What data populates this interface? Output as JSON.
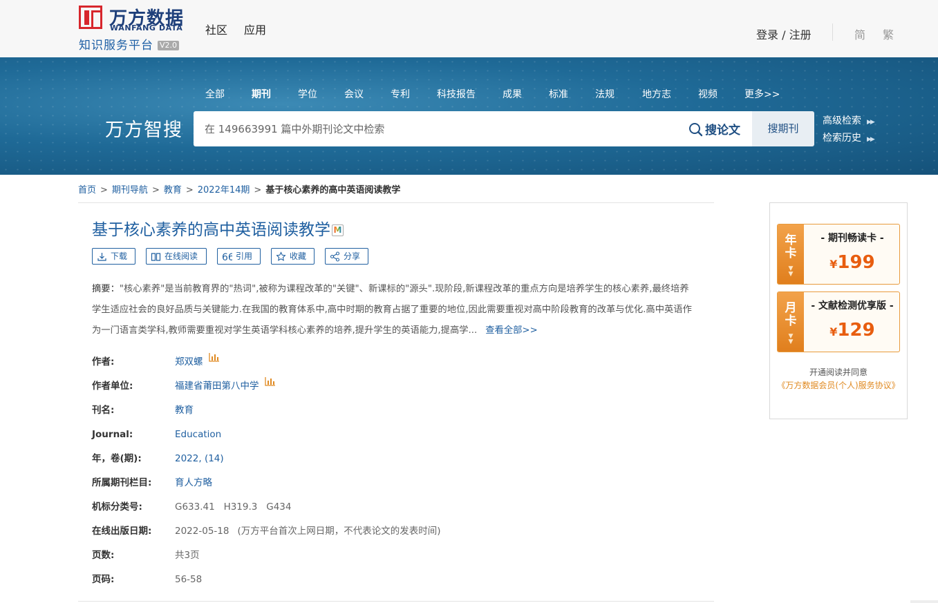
{
  "header": {
    "logo_cn": "万方数据",
    "logo_en": "WANFANG DATA",
    "logo_sub": "知识服务平台",
    "version": "V2.0",
    "nav": [
      "社区",
      "应用"
    ],
    "login": "登录 / 注册",
    "lang_simplified": "简",
    "lang_traditional": "繁"
  },
  "banner": {
    "categories": [
      "全部",
      "期刊",
      "学位",
      "会议",
      "专利",
      "科技报告",
      "成果",
      "标准",
      "法规",
      "地方志",
      "视频",
      "更多>>"
    ],
    "active_category": "期刊",
    "brand": "万方智搜",
    "search_placeholder": "在 149663991 篇中外期刊论文中检索",
    "search_button": "搜论文",
    "search_journal_button": "搜期刊",
    "advanced_search": "高级检索",
    "search_history": "检索历史"
  },
  "breadcrumb": {
    "items": [
      "首页",
      "期刊导航",
      "教育",
      "2022年14期"
    ],
    "current": "基于核心素养的高中英语阅读教学"
  },
  "article": {
    "title": "基于核心素养的高中英语阅读教学",
    "title_badge": "M",
    "actions": {
      "download": "下载",
      "read_online": "在线阅读",
      "cite": "引用",
      "favorite": "收藏",
      "share": "分享"
    },
    "abstract_label": "摘要：",
    "abstract_text": "\"核心素养\"是当前教育界的\"热词\",被称为课程改革的\"关键\"、新课标的\"源头\".现阶段,新课程改革的重点方向是培养学生的核心素养,最终培养学生适应社会的良好品质与关键能力.在我国的教育体系中,高中时期的教育占据了重要的地位,因此需要重视对高中阶段教育的改革与优化.高中英语作为一门语言类学科,教师需要重视对学生英语学科核心素养的培养,提升学生的英语能力,提高学...",
    "view_all": "查看全部>>",
    "meta": {
      "author_label": "作者:",
      "author": "郑双螺",
      "affiliation_label": "作者单位:",
      "affiliation": "福建省莆田第八中学",
      "journal_cn_label": "刊名:",
      "journal_cn": "教育",
      "journal_en_label": "Journal:",
      "journal_en": "Education",
      "year_issue_label": "年，卷(期):",
      "year_issue": "2022, (14)",
      "column_label": "所属期刊栏目:",
      "column": "育人方略",
      "classification_label": "机标分类号:",
      "classification": "G633.41   H319.3   G434",
      "online_date_label": "在线出版日期:",
      "online_date": "2022-05-18",
      "online_date_note": "(万方平台首次上网日期，不代表论文的发表时间)",
      "pages_count_label": "页数:",
      "pages_count": "共3页",
      "page_range_label": "页码:",
      "page_range": "56-58"
    }
  },
  "sidebar": {
    "year_card": {
      "tab": "年卡",
      "name": "- 期刊畅读卡 -",
      "currency": "¥",
      "price": "199"
    },
    "month_card": {
      "tab": "月卡",
      "name": "- 文献检测优享版 -",
      "currency": "¥",
      "price": "129"
    },
    "agree_text": "开通阅读并同意",
    "agree_link": "《万方数据会员(个人)服务协议》"
  },
  "colors": {
    "link_blue": "#1f5fa0",
    "brand_red": "#d7262c",
    "accent_orange": "#e85d0f",
    "banner_blue": "#1f6a97"
  }
}
